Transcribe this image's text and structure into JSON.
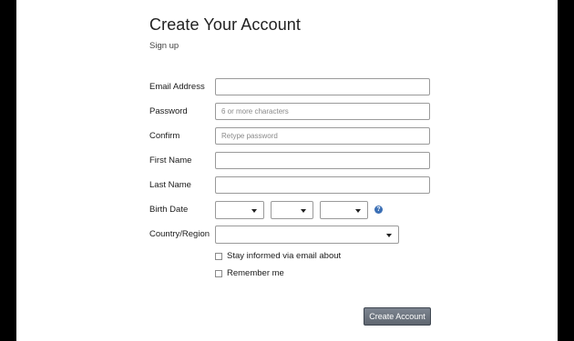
{
  "page": {
    "title": "Create Your Account",
    "subtitle": "Sign up"
  },
  "form": {
    "email": {
      "label": "Email Address",
      "value": "",
      "placeholder": ""
    },
    "password": {
      "label": "Password",
      "value": "",
      "placeholder": "6 or more characters"
    },
    "confirm": {
      "label": "Confirm",
      "value": "",
      "placeholder": "Retype password"
    },
    "first_name": {
      "label": "First Name",
      "value": "",
      "placeholder": ""
    },
    "last_name": {
      "label": "Last Name",
      "value": "",
      "placeholder": ""
    },
    "birth_date": {
      "label": "Birth Date",
      "month": "",
      "day": "",
      "year": "",
      "help_icon": "question-circle-icon",
      "help_glyph": "?"
    },
    "country": {
      "label": "Country/Region",
      "value": ""
    },
    "checkboxes": [
      {
        "label": "Stay informed via email about",
        "checked": false
      },
      {
        "label": "Remember me",
        "checked": false
      }
    ],
    "submit_label": "Create Account"
  },
  "colors": {
    "background": "#000000",
    "panel": "#ffffff",
    "button": "#6b727c",
    "help_icon": "#3b6fb5"
  }
}
